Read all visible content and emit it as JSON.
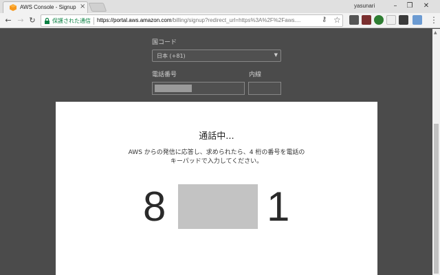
{
  "browser": {
    "tab_title": "AWS Console - Signup",
    "profile_name": "yasunari",
    "window_controls": {
      "minimize": "–",
      "maximize": "❐",
      "close": "✕"
    },
    "omnibox": {
      "secure_label": "保護された通信",
      "url_host": "https://portal.aws.amazon.com",
      "url_rest": "/billing/signup?redirect_url=https%3A%2F%2Faws...."
    }
  },
  "form": {
    "country_code_label": "国コード",
    "country_code_value": "日本 (+81)",
    "phone_label": "電話番号",
    "extension_label": "内線"
  },
  "modal": {
    "title": "通話中...",
    "instruction_line1": "AWS からの発信に応答し、求められたら、4 桁の番号を電話の",
    "instruction_line2": "キーパッドで入力してください。",
    "digit_first": "8",
    "digit_last": "1"
  },
  "colors": {
    "overlay": "#4b4b4b",
    "secure_green": "#0b8043",
    "aws_orange": "#f7981d"
  },
  "icons": [
    "back-arrow-icon",
    "forward-arrow-icon",
    "reload-icon",
    "lock-icon",
    "key-icon",
    "star-icon",
    "menu-icon"
  ]
}
